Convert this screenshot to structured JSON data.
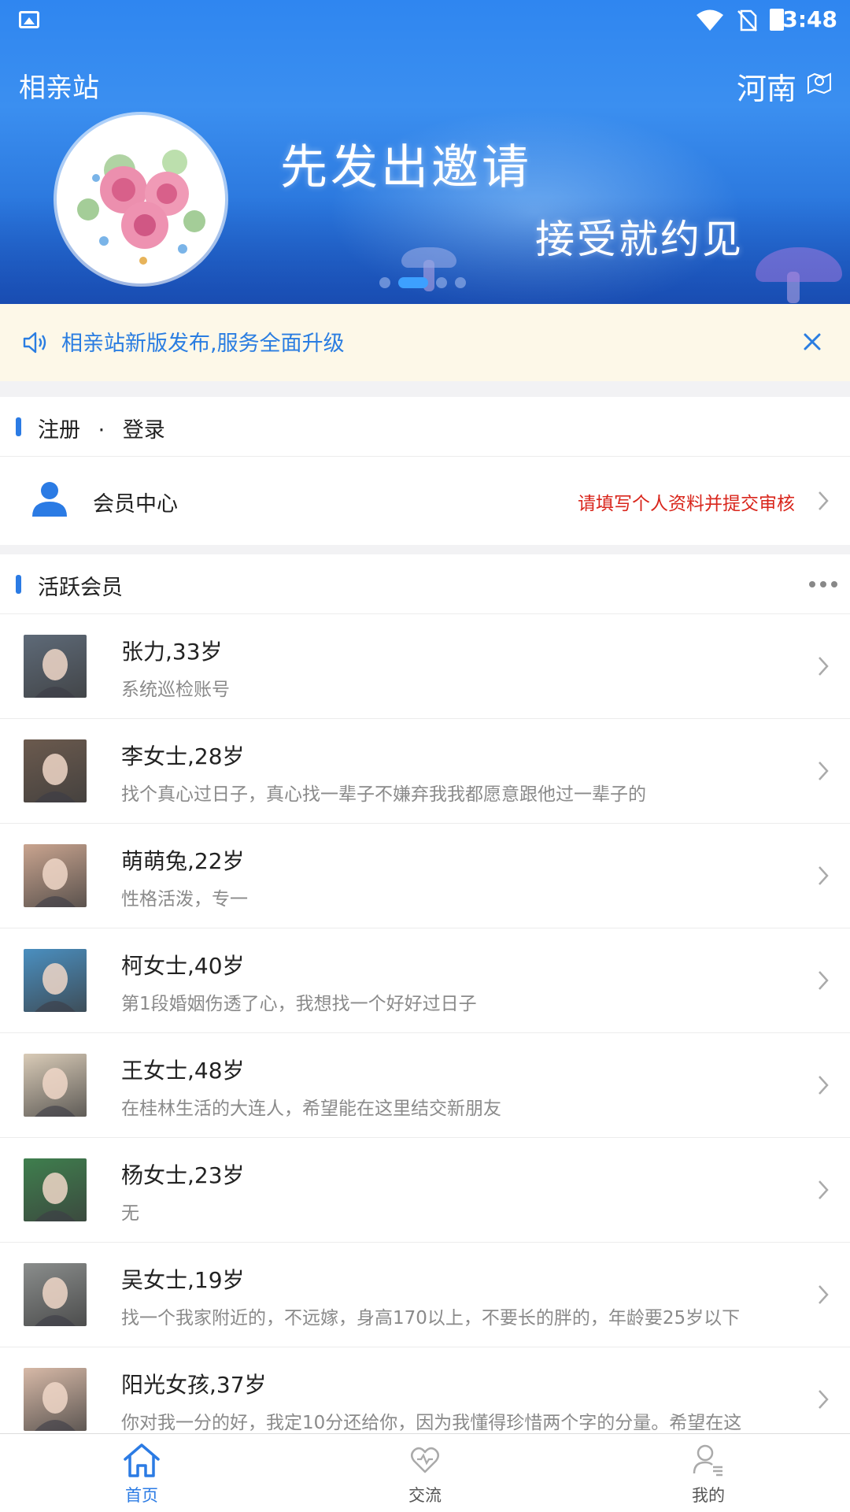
{
  "status_bar": {
    "time": "3:48"
  },
  "header": {
    "app_title": "相亲站",
    "region": "河南",
    "banner_line1": "先发出邀请",
    "banner_line2": "接受就约见",
    "banner_page_active": 2,
    "banner_page_count": 4
  },
  "notice": {
    "text": "相亲站新版发布,服务全面升级"
  },
  "auth_section": {
    "register": "注册",
    "separator": "·",
    "login": "登录",
    "member_center_label": "会员中心",
    "member_center_hint": "请填写个人资料并提交审核"
  },
  "active_section": {
    "title": "活跃会员",
    "members": [
      {
        "name": "张力,33岁",
        "bio": "系统巡检账号",
        "thumb_color": "#5e6a78"
      },
      {
        "name": "李女士,28岁",
        "bio": "找个真心过日子，真心找一辈子不嫌弃我我都愿意跟他过一辈子的",
        "thumb_color": "#6b5a4e"
      },
      {
        "name": "萌萌兔,22岁",
        "bio": "性格活泼，专一",
        "thumb_color": "#c9a48f"
      },
      {
        "name": "柯女士,40岁",
        "bio": "第1段婚姻伤透了心，我想找一个好好过日子",
        "thumb_color": "#4a8fc0"
      },
      {
        "name": "王女士,48岁",
        "bio": "在桂林生活的大连人，希望能在这里结交新朋友",
        "thumb_color": "#d9cbb7"
      },
      {
        "name": "杨女士,23岁",
        "bio": "无",
        "thumb_color": "#3f7f4e"
      },
      {
        "name": "吴女士,19岁",
        "bio": "找一个我家附近的，不远嫁，身高170以上，不要长的胖的，年龄要25岁以下",
        "thumb_color": "#8a8d8c"
      },
      {
        "name": "阳光女孩,37岁",
        "bio": "你对我一分的好，我定10分还给你，因为我懂得珍惜两个字的分量。希望在这",
        "thumb_color": "#d7b9a7"
      }
    ]
  },
  "bottom_nav": [
    {
      "label": "首页",
      "icon": "home-icon",
      "active": true
    },
    {
      "label": "交流",
      "icon": "heart-chat-icon",
      "active": false
    },
    {
      "label": "我的",
      "icon": "profile-icon",
      "active": false
    }
  ],
  "colors": {
    "primary": "#2b7be4",
    "notice_bg": "#fdf8e8",
    "warning": "#d9261c"
  }
}
